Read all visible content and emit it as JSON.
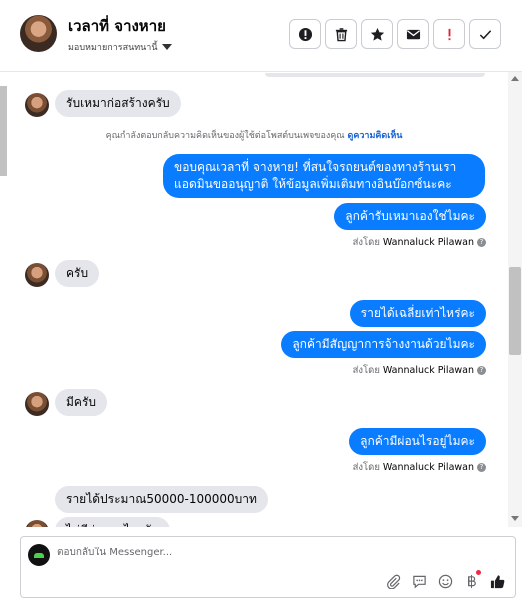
{
  "header": {
    "contact_name": "เวลาที่ จางหาย",
    "assign_label": "มอบหมายการสนทนานี้",
    "action_icons": [
      "alert-circle-icon",
      "trash-icon",
      "star-icon",
      "envelope-icon",
      "exclamation-icon",
      "check-icon"
    ]
  },
  "chat": {
    "notice_text": "คุณกำลังตอบกลับความคิดเห็นของผู้ใช้ต่อโพสต์บนเพจของคุณ",
    "notice_link": "ดูความคิดเห็น",
    "messages": [
      {
        "from": "customer",
        "text": "รับเหมาก่อสร้างครับ"
      },
      {
        "from": "page",
        "text": "ขอบคุณเวลาที่ จางหาย! ที่สนใจรถยนต์ของทางร้านเรา แอดมินขออนุญาติ ให้ข้อมูลเพิ่มเติมทางอินบ๊อกซ์นะคะ"
      },
      {
        "from": "page",
        "text": "ลูกค้ารับเหมาเองใช่ไมคะ"
      },
      {
        "from": "customer",
        "text": "ครับ"
      },
      {
        "from": "page",
        "text": "รายได้เฉลี่ยเท่าไหร่คะ"
      },
      {
        "from": "page",
        "text": "ลูกค้ามีสัญญาการจ้างงานด้วยไมคะ"
      },
      {
        "from": "customer",
        "text": "มีครับ"
      },
      {
        "from": "page",
        "text": "ลูกค้ามีผ่อนไรอยู่ไมคะ"
      },
      {
        "from": "customer",
        "text": "รายได้ประมาณ50000-100000บาท"
      },
      {
        "from": "customer",
        "text": "ไม่มีผ่อนอะไรครับ"
      }
    ],
    "sent_by_prefix": "ส่งโดย",
    "sent_by_name": "Wannaluck Pilawan",
    "help_glyph": "?"
  },
  "composer": {
    "placeholder": "ตอบกลับใน Messenger...",
    "tool_icons": [
      "paperclip-icon",
      "saved-reply-icon",
      "emoji-icon",
      "baht-icon",
      "like-icon"
    ]
  },
  "colors": {
    "outgoing_bubble": "#0a7cff",
    "incoming_bubble": "#e4e6eb",
    "link": "#1763cf"
  }
}
